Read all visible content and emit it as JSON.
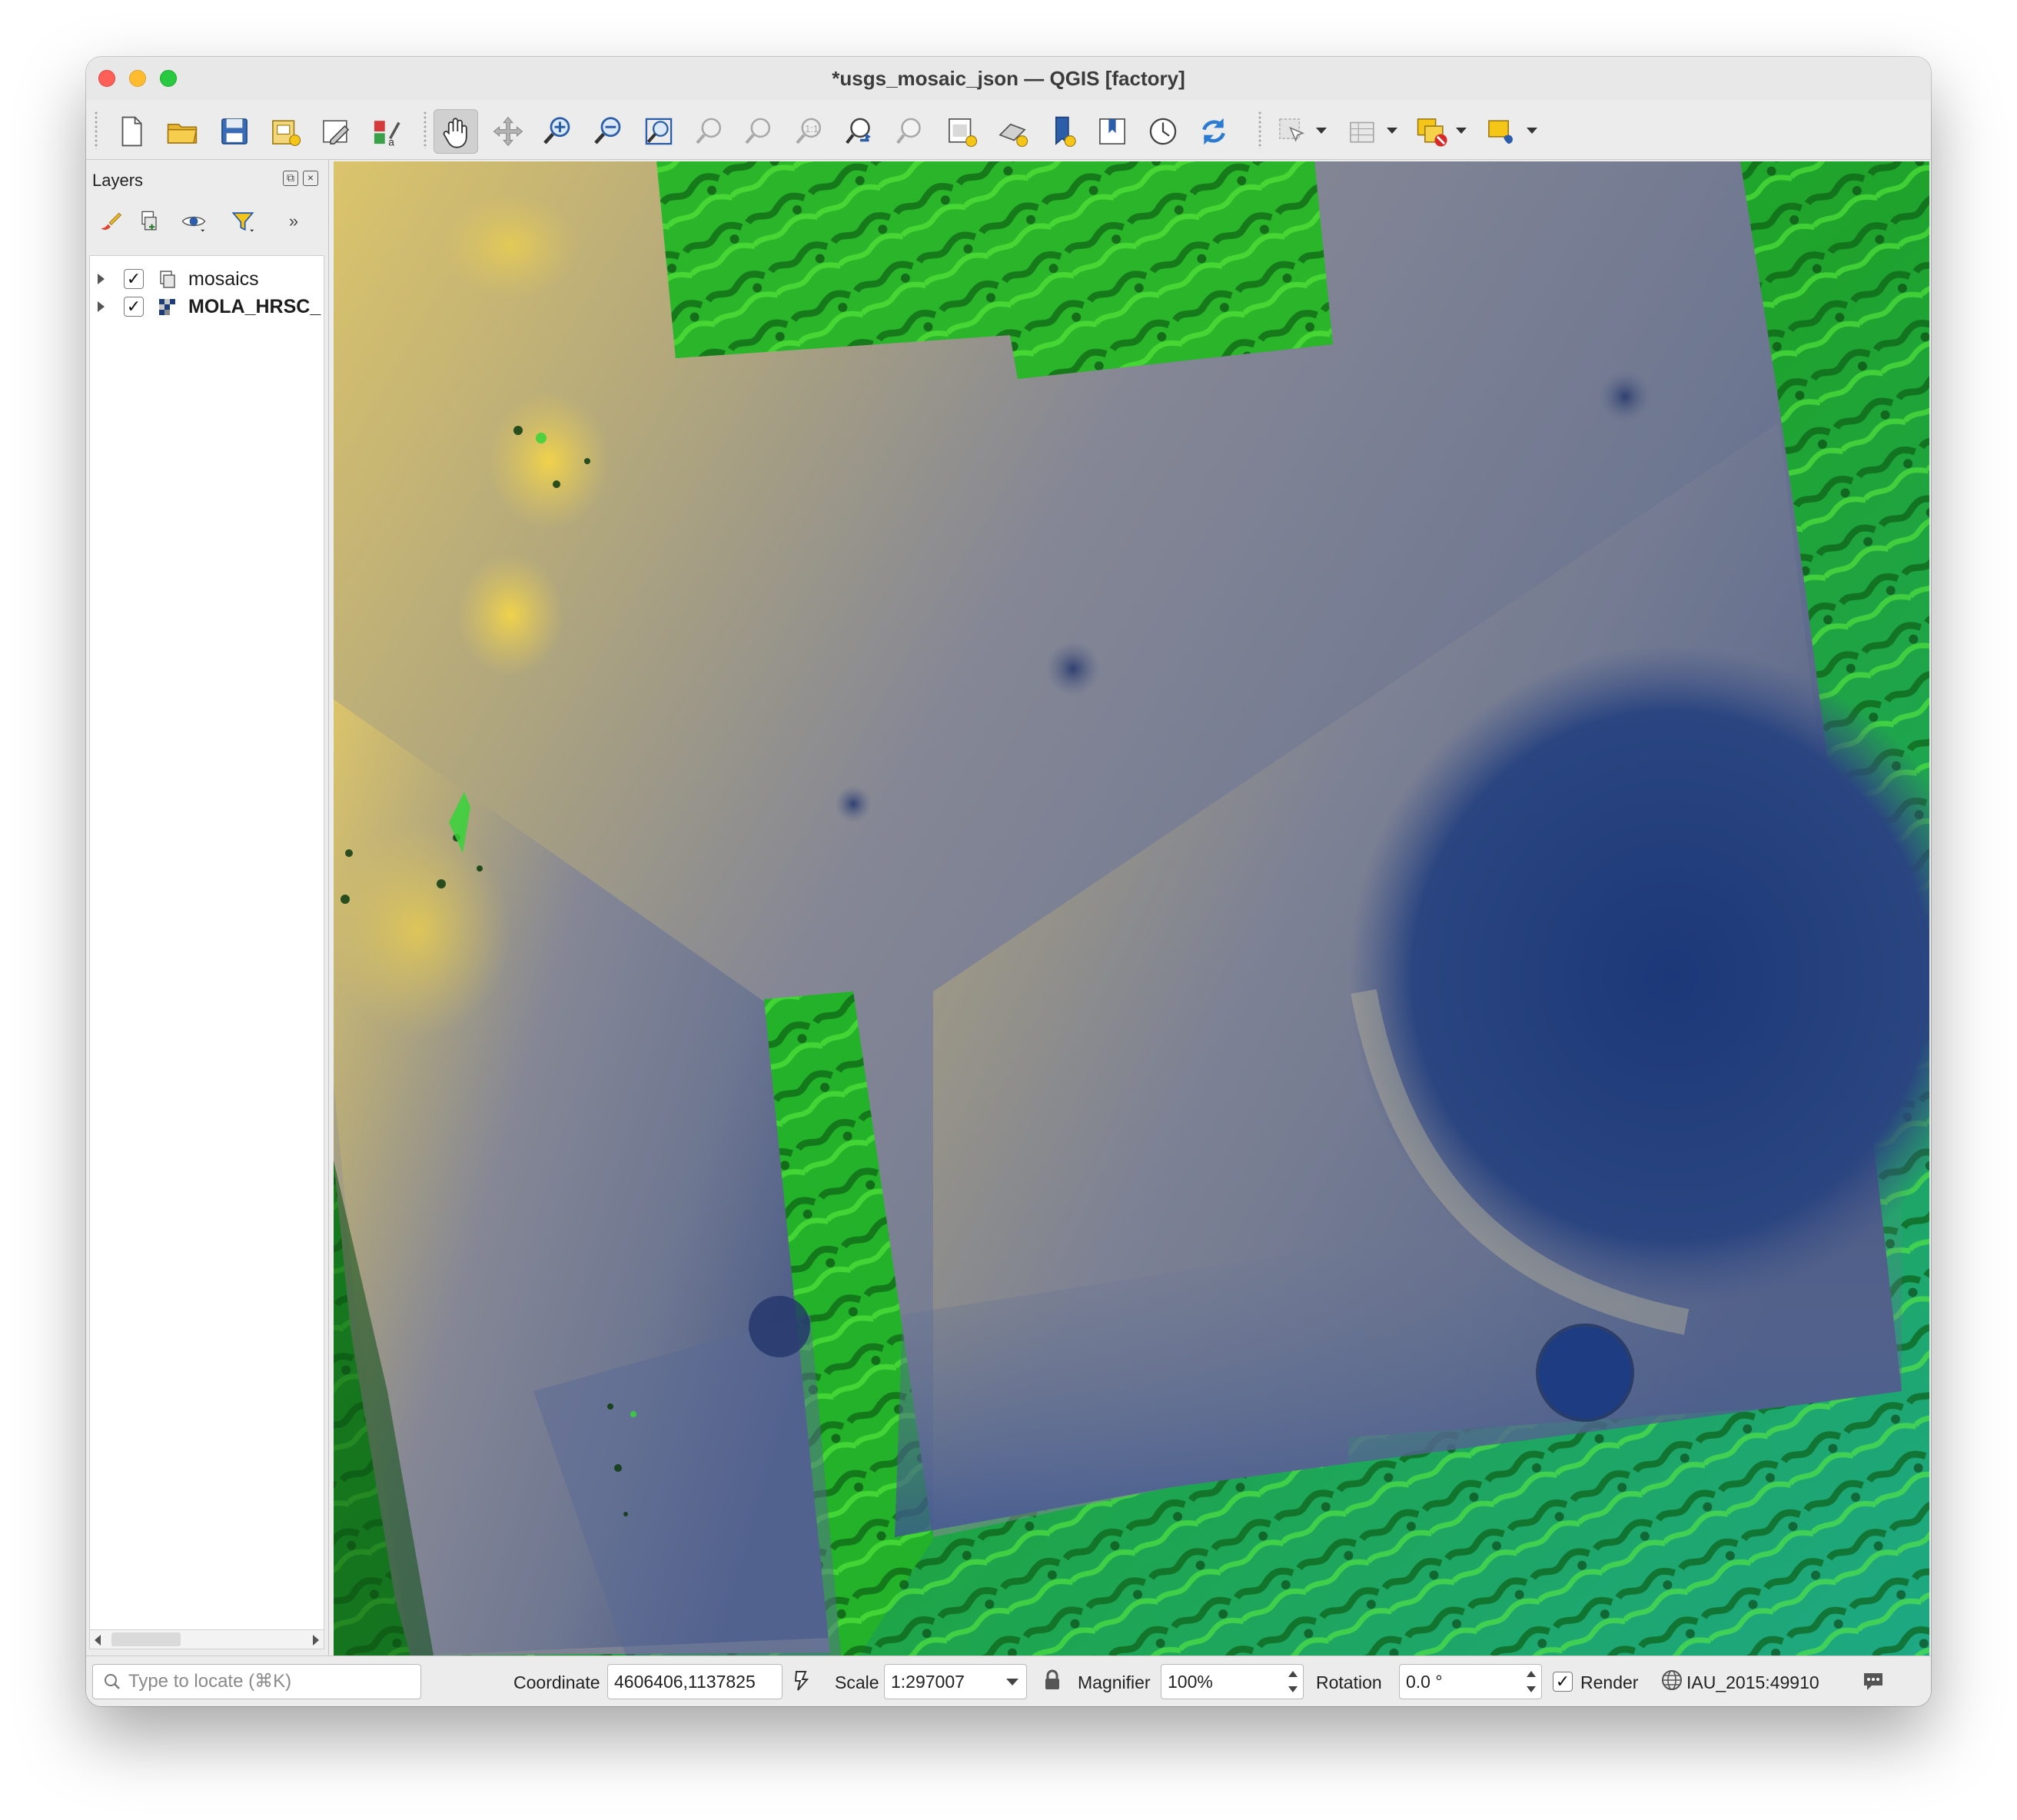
{
  "window": {
    "title": "*usgs_mosaic_json — QGIS [factory]"
  },
  "toolbar": {
    "buttons": [
      "new-project",
      "open-project",
      "save-project",
      "new-print-layout",
      "layout-manager",
      "style-manager",
      "pan-map",
      "pan-to-selection",
      "zoom-in",
      "zoom-out",
      "zoom-full",
      "zoom-to-selection",
      "zoom-to-layer",
      "zoom-native",
      "zoom-last",
      "zoom-next",
      "new-map-view",
      "new-3d-map-view",
      "new-bookmark",
      "show-bookmarks",
      "temporal-controller",
      "refresh",
      "select-features",
      "attribute-table",
      "deselect-all",
      "add-annotation"
    ],
    "active": "pan-map"
  },
  "layers_panel": {
    "title": "Layers",
    "layers": [
      {
        "name": "mosaics",
        "checked": true,
        "icon": "group-icon",
        "bold": false
      },
      {
        "name": "MOLA_HRSC_",
        "checked": true,
        "icon": "raster-icon",
        "bold": true
      }
    ]
  },
  "statusbar": {
    "locator_placeholder": "Type to locate (⌘K)",
    "coordinate_label": "Coordinate",
    "coordinate_value": "4606406,1137825",
    "scale_label": "Scale",
    "scale_value": "1:297007",
    "magnifier_label": "Magnifier",
    "magnifier_value": "100%",
    "rotation_label": "Rotation",
    "rotation_value": "0.0 °",
    "render_label": "Render",
    "render_checked": true,
    "crs": "IAU_2015:49910"
  },
  "colors": {
    "terrain_green": "#22b02e",
    "mosaic_yellow": "#d9c066",
    "mosaic_gray": "#7c8296",
    "mosaic_blue": "#283f7a"
  }
}
